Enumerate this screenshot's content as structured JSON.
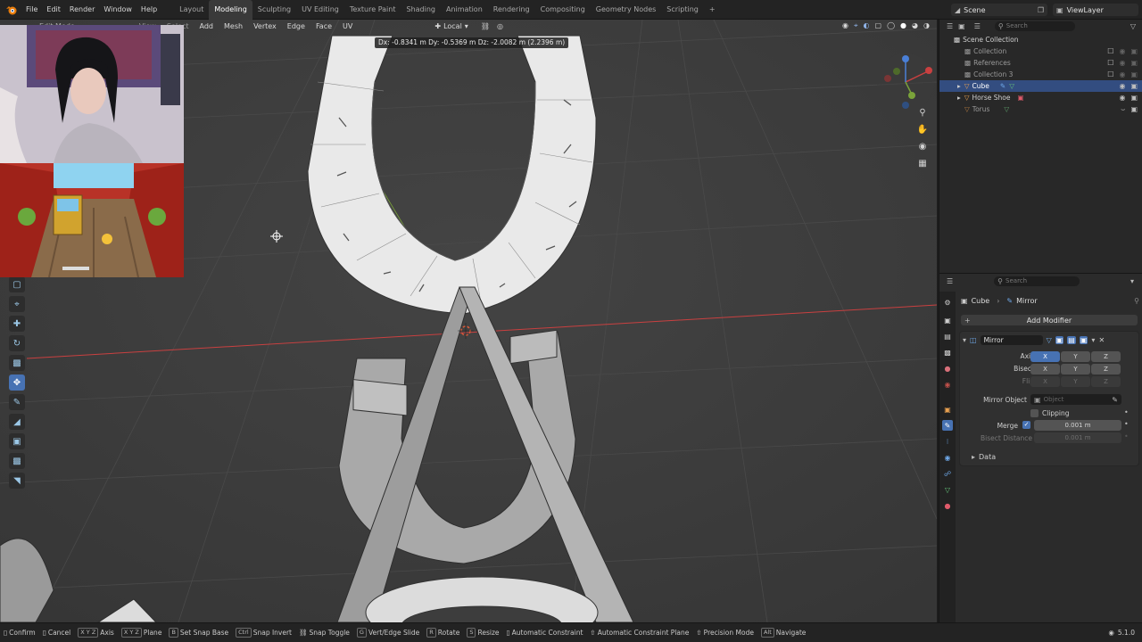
{
  "topbar": {
    "menus": [
      "File",
      "Edit",
      "Render",
      "Window",
      "Help"
    ],
    "workspaces": [
      "Layout",
      "Modeling",
      "Sculpting",
      "UV Editing",
      "Texture Paint",
      "Shading",
      "Animation",
      "Rendering",
      "Compositing",
      "Geometry Nodes",
      "Scripting"
    ],
    "active_workspace": "Modeling",
    "add_tab": "+",
    "scene_label": "Scene",
    "view_layer_label": "ViewLayer"
  },
  "viewport": {
    "mode_label": "Edit Mode",
    "menus": [
      "View",
      "Select",
      "Add",
      "Mesh",
      "Vertex",
      "Edge",
      "Face",
      "UV"
    ],
    "orientation_label": "Local",
    "delta_readout": "Dx: -0.8341 m   Dy: -0.5369 m   Dz: -2.0082 m (2.2396 m)",
    "accent_color": "#4772b3",
    "x_axis_color": "#c94040",
    "y_axis_color": "#7aa33a"
  },
  "outliner": {
    "search_placeholder": "Search",
    "items": [
      {
        "label": "Scene Collection",
        "icon": "collection-icon"
      },
      {
        "label": "Collection",
        "icon": "collection-icon"
      },
      {
        "label": "References",
        "icon": "collection-icon"
      },
      {
        "label": "Collection 3",
        "icon": "collection-icon"
      },
      {
        "label": "Cube",
        "icon": "mesh-icon"
      },
      {
        "label": "Horse Shoe",
        "icon": "mesh-icon"
      },
      {
        "label": "Torus",
        "icon": "mesh-icon"
      }
    ]
  },
  "properties": {
    "search_placeholder": "Search",
    "breadcrumb_object": "Cube",
    "breadcrumb_modifier": "Mirror",
    "add_modifier_label": "Add Modifier",
    "modifier_name": "Mirror",
    "axis_label": "Axis",
    "bisect_label": "Bisect",
    "flip_label": "Flip",
    "axes": [
      "X",
      "Y",
      "Z"
    ],
    "mirror_object_label": "Mirror Object",
    "mirror_object_placeholder": "Object",
    "clipping_label": "Clipping",
    "merge_label": "Merge",
    "merge_value": "0.001 m",
    "bisect_distance_label": "Bisect Distance",
    "bisect_distance_value": "0.001 m",
    "data_label": "Data"
  },
  "statusbar": {
    "items": [
      {
        "key": "",
        "label": "Confirm"
      },
      {
        "key": "",
        "label": "Cancel"
      },
      {
        "key": "X Y Z",
        "label": "Axis"
      },
      {
        "key": "X Y Z",
        "label": "Plane"
      },
      {
        "key": "B",
        "label": "Set Snap Base"
      },
      {
        "key": "Ctrl",
        "label": "Snap Invert"
      },
      {
        "key": "",
        "label": "Snap Toggle"
      },
      {
        "key": "G",
        "label": "Vert/Edge Slide"
      },
      {
        "key": "R",
        "label": "Rotate"
      },
      {
        "key": "S",
        "label": "Resize"
      },
      {
        "key": "",
        "label": "Automatic Constraint"
      },
      {
        "key": "",
        "label": "Automatic Constraint Plane"
      },
      {
        "key": "",
        "label": "Precision Mode"
      },
      {
        "key": "Alt",
        "label": "Navigate"
      }
    ],
    "version": "5.1.0"
  }
}
